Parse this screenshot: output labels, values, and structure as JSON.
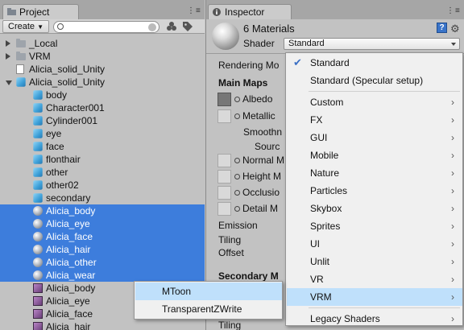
{
  "project": {
    "tab_label": "Project",
    "window_controls": "⋮≡",
    "create_label": "Create",
    "tree": [
      {
        "label": "_Local",
        "icon": "folder-icon",
        "expand": "collapsed",
        "indent": 0,
        "selected": false
      },
      {
        "label": "VRM",
        "icon": "folder-icon",
        "expand": "collapsed",
        "indent": 0,
        "selected": false
      },
      {
        "label": "Alicia_solid_Unity",
        "icon": "document-icon",
        "expand": "none",
        "indent": 0,
        "selected": false
      },
      {
        "label": "Alicia_solid_Unity",
        "icon": "prefab-icon",
        "expand": "expanded",
        "indent": 0,
        "selected": false
      },
      {
        "label": "body",
        "icon": "mesh-cube-icon",
        "expand": "none",
        "indent": 1,
        "selected": false
      },
      {
        "label": "Character001",
        "icon": "mesh-cube-icon",
        "expand": "none",
        "indent": 1,
        "selected": false
      },
      {
        "label": "Cylinder001",
        "icon": "mesh-cube-icon",
        "expand": "none",
        "indent": 1,
        "selected": false
      },
      {
        "label": "eye",
        "icon": "mesh-cube-icon",
        "expand": "none",
        "indent": 1,
        "selected": false
      },
      {
        "label": "face",
        "icon": "mesh-cube-icon",
        "expand": "none",
        "indent": 1,
        "selected": false
      },
      {
        "label": "flonthair",
        "icon": "mesh-cube-icon",
        "expand": "none",
        "indent": 1,
        "selected": false
      },
      {
        "label": "other",
        "icon": "mesh-cube-icon",
        "expand": "none",
        "indent": 1,
        "selected": false
      },
      {
        "label": "other02",
        "icon": "mesh-cube-icon",
        "expand": "none",
        "indent": 1,
        "selected": false
      },
      {
        "label": "secondary",
        "icon": "mesh-cube-icon",
        "expand": "none",
        "indent": 1,
        "selected": false
      },
      {
        "label": "Alicia_body",
        "icon": "material-sphere-icon",
        "expand": "none",
        "indent": 1,
        "selected": true
      },
      {
        "label": "Alicia_eye",
        "icon": "material-sphere-icon",
        "expand": "none",
        "indent": 1,
        "selected": true
      },
      {
        "label": "Alicia_face",
        "icon": "material-sphere-icon",
        "expand": "none",
        "indent": 1,
        "selected": true
      },
      {
        "label": "Alicia_hair",
        "icon": "material-sphere-icon",
        "expand": "none",
        "indent": 1,
        "selected": true
      },
      {
        "label": "Alicia_other",
        "icon": "material-sphere-icon",
        "expand": "none",
        "indent": 1,
        "selected": true
      },
      {
        "label": "Alicia_wear",
        "icon": "material-sphere-icon",
        "expand": "none",
        "indent": 1,
        "selected": true
      },
      {
        "label": "Alicia_body",
        "icon": "texture-icon",
        "expand": "none",
        "indent": 1,
        "selected": false
      },
      {
        "label": "Alicia_eye",
        "icon": "texture-icon",
        "expand": "none",
        "indent": 1,
        "selected": false
      },
      {
        "label": "Alicia_face",
        "icon": "texture-icon",
        "expand": "none",
        "indent": 1,
        "selected": false
      },
      {
        "label": "Alicia_hair",
        "icon": "texture-icon",
        "expand": "none",
        "indent": 1,
        "selected": false
      }
    ]
  },
  "inspector": {
    "tab_label": "Inspector",
    "window_controls": "⋮≡",
    "title": "6 Materials",
    "shader_label": "Shader",
    "shader_value": "Standard",
    "rendering_mode_label": "Rendering Mo",
    "main_maps_header": "Main Maps",
    "albedo_label": "Albedo",
    "metallic_label": "Metallic",
    "smoothness_label": "Smoothn",
    "source_label": "Sourc",
    "normal_map_label": "Normal M",
    "height_map_label": "Height M",
    "occlusion_label": "Occlusio",
    "detail_mask_label": "Detail M",
    "emission_label": "Emission",
    "tiling_label": "Tiling",
    "offset_label": "Offset",
    "secondary_header": "Secondary M",
    "tiling2_label": "Tiling"
  },
  "shader_menu": {
    "items": [
      {
        "label": "Standard",
        "checked": true,
        "submenu": false,
        "highlighted": false
      },
      {
        "label": "Standard (Specular setup)",
        "checked": false,
        "submenu": false,
        "highlighted": false
      },
      {
        "label": "Custom",
        "checked": false,
        "submenu": true,
        "highlighted": false
      },
      {
        "label": "FX",
        "checked": false,
        "submenu": true,
        "highlighted": false
      },
      {
        "label": "GUI",
        "checked": false,
        "submenu": true,
        "highlighted": false
      },
      {
        "label": "Mobile",
        "checked": false,
        "submenu": true,
        "highlighted": false
      },
      {
        "label": "Nature",
        "checked": false,
        "submenu": true,
        "highlighted": false
      },
      {
        "label": "Particles",
        "checked": false,
        "submenu": true,
        "highlighted": false
      },
      {
        "label": "Skybox",
        "checked": false,
        "submenu": true,
        "highlighted": false
      },
      {
        "label": "Sprites",
        "checked": false,
        "submenu": true,
        "highlighted": false
      },
      {
        "label": "UI",
        "checked": false,
        "submenu": true,
        "highlighted": false
      },
      {
        "label": "Unlit",
        "checked": false,
        "submenu": true,
        "highlighted": false
      },
      {
        "label": "VR",
        "checked": false,
        "submenu": true,
        "highlighted": false
      },
      {
        "label": "VRM",
        "checked": false,
        "submenu": true,
        "highlighted": true
      },
      {
        "label": "Legacy Shaders",
        "checked": false,
        "submenu": true,
        "highlighted": false
      }
    ],
    "separator_after": [
      "Standard (Specular setup)",
      "VRM"
    ],
    "check_glyph": "✔",
    "chevron_glyph": "›"
  },
  "vrm_submenu": {
    "items": [
      {
        "label": "MToon",
        "highlighted": true
      },
      {
        "label": "TransparentZWrite",
        "highlighted": false
      }
    ]
  },
  "colors": {
    "selection": "#3d7ddc",
    "menu_highlight": "#bfe0fb",
    "panel_bg": "#c2c2c2"
  }
}
